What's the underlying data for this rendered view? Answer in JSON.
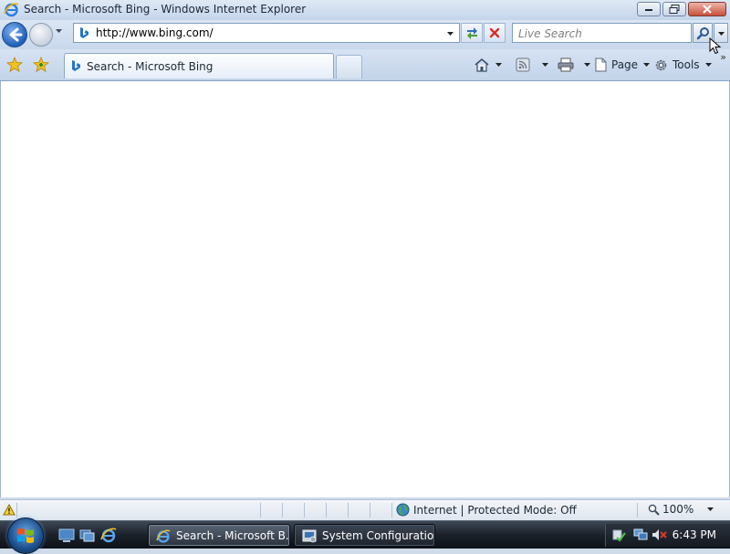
{
  "window": {
    "title": "Search - Microsoft Bing - Windows Internet Explorer",
    "controls": [
      "minimize",
      "maximize",
      "close"
    ]
  },
  "address_bar": {
    "url": "http://www.bing.com/"
  },
  "search": {
    "placeholder": "Live Search"
  },
  "tabs": [
    {
      "label": "Search - Microsoft Bing",
      "active": true
    }
  ],
  "command_bar": {
    "page_label": "Page",
    "tools_label": "Tools"
  },
  "status_bar": {
    "zone_text": "Internet | Protected Mode: Off",
    "zoom": "100%"
  },
  "taskbar": {
    "items": [
      {
        "label": "Search - Microsoft B...",
        "active": true,
        "icon": "ie-icon"
      },
      {
        "label": "System Configuration",
        "active": false,
        "icon": "msconfig-icon"
      }
    ],
    "clock": "6:43 PM"
  },
  "colors": {
    "chrome": "#cfdbe9",
    "taskbar": "#1c222b",
    "link_blue": "#1f5fb7"
  }
}
